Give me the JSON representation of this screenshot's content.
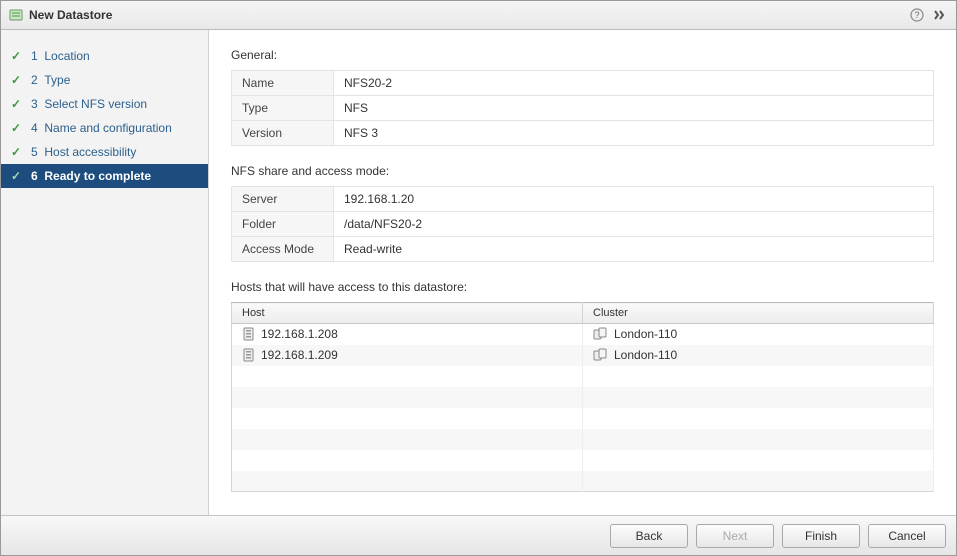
{
  "window": {
    "title": "New Datastore"
  },
  "sidebar": {
    "steps": [
      {
        "num": "1",
        "label": "Location"
      },
      {
        "num": "2",
        "label": "Type"
      },
      {
        "num": "3",
        "label": "Select NFS version"
      },
      {
        "num": "4",
        "label": "Name and configuration"
      },
      {
        "num": "5",
        "label": "Host accessibility"
      },
      {
        "num": "6",
        "label": "Ready to complete"
      }
    ]
  },
  "sections": {
    "general_label": "General:",
    "general": {
      "name_k": "Name",
      "name_v": "NFS20-2",
      "type_k": "Type",
      "type_v": "NFS",
      "version_k": "Version",
      "version_v": "NFS 3"
    },
    "share_label": "NFS share and access mode:",
    "share": {
      "server_k": "Server",
      "server_v": "192.168.1.20",
      "folder_k": "Folder",
      "folder_v": "/data/NFS20-2",
      "mode_k": "Access Mode",
      "mode_v": "Read-write"
    },
    "hosts_label": "Hosts that will have access to this datastore:",
    "hosts_header": {
      "host": "Host",
      "cluster": "Cluster"
    },
    "hosts": [
      {
        "host": "192.168.1.208",
        "cluster": "London-110"
      },
      {
        "host": "192.168.1.209",
        "cluster": "London-110"
      }
    ]
  },
  "footer": {
    "back": "Back",
    "next": "Next",
    "finish": "Finish",
    "cancel": "Cancel"
  }
}
